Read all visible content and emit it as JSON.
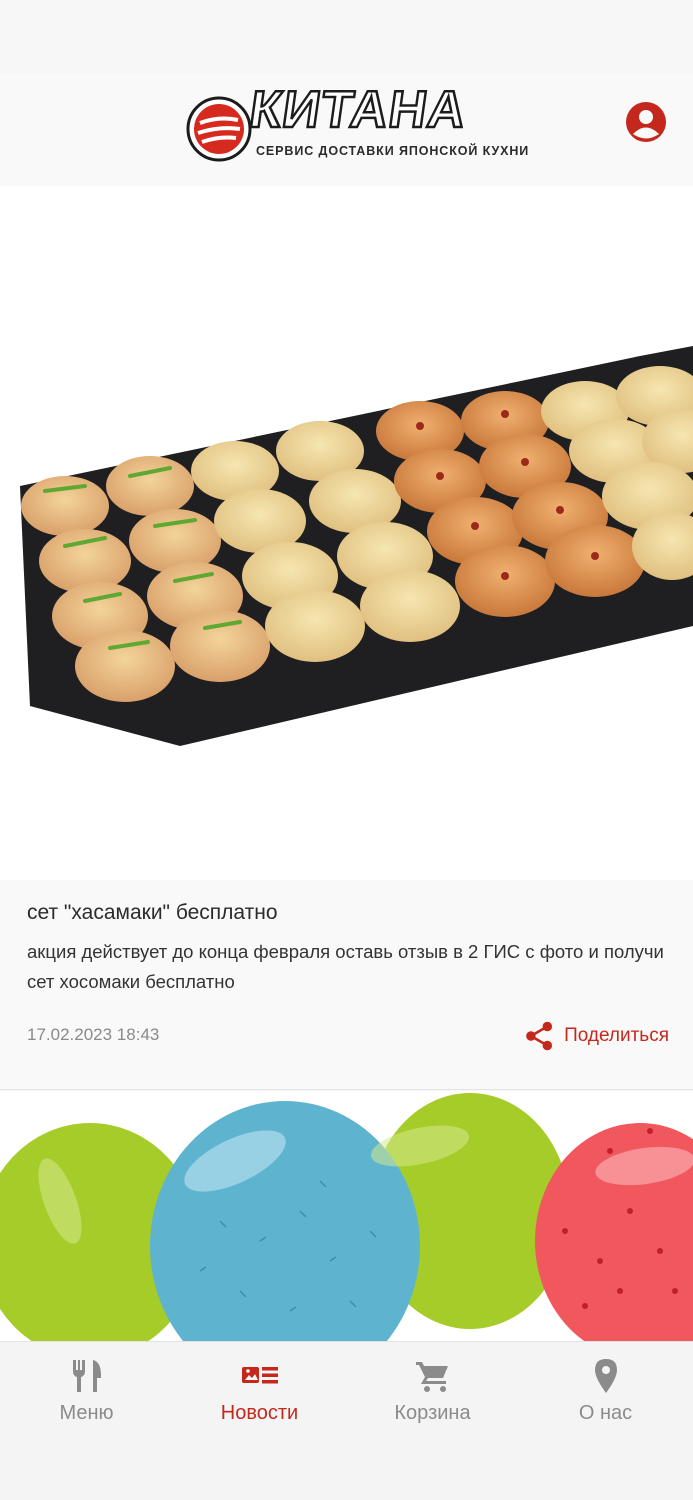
{
  "header": {
    "logo_word": "КИТАНА",
    "logo_tagline": "СЕРВИС ДОСТАВКИ ЯПОНСКОЙ КУХНИ"
  },
  "icons": {
    "profile": "account-circle-icon",
    "share": "share-icon",
    "menu": "fork-knife-icon",
    "news": "news-icon",
    "cart": "cart-icon",
    "about": "location-pin-icon"
  },
  "news_item": {
    "title": "сет \"хасамаки\" бесплатно",
    "body": "акция действует до конца февраля оставь отзыв в 2 ГИС с фото и получи сет хосомаки бесплатно",
    "date": "17.02.2023 18:43",
    "share_label": "Поделиться"
  },
  "tabs": [
    {
      "label": "Меню",
      "active": false
    },
    {
      "label": "Новости",
      "active": true
    },
    {
      "label": "Корзина",
      "active": false
    },
    {
      "label": "О нас",
      "active": false
    }
  ],
  "colors": {
    "accent": "#c4281c",
    "inactive": "#8b8b8b",
    "background": "#f7f7f8"
  }
}
